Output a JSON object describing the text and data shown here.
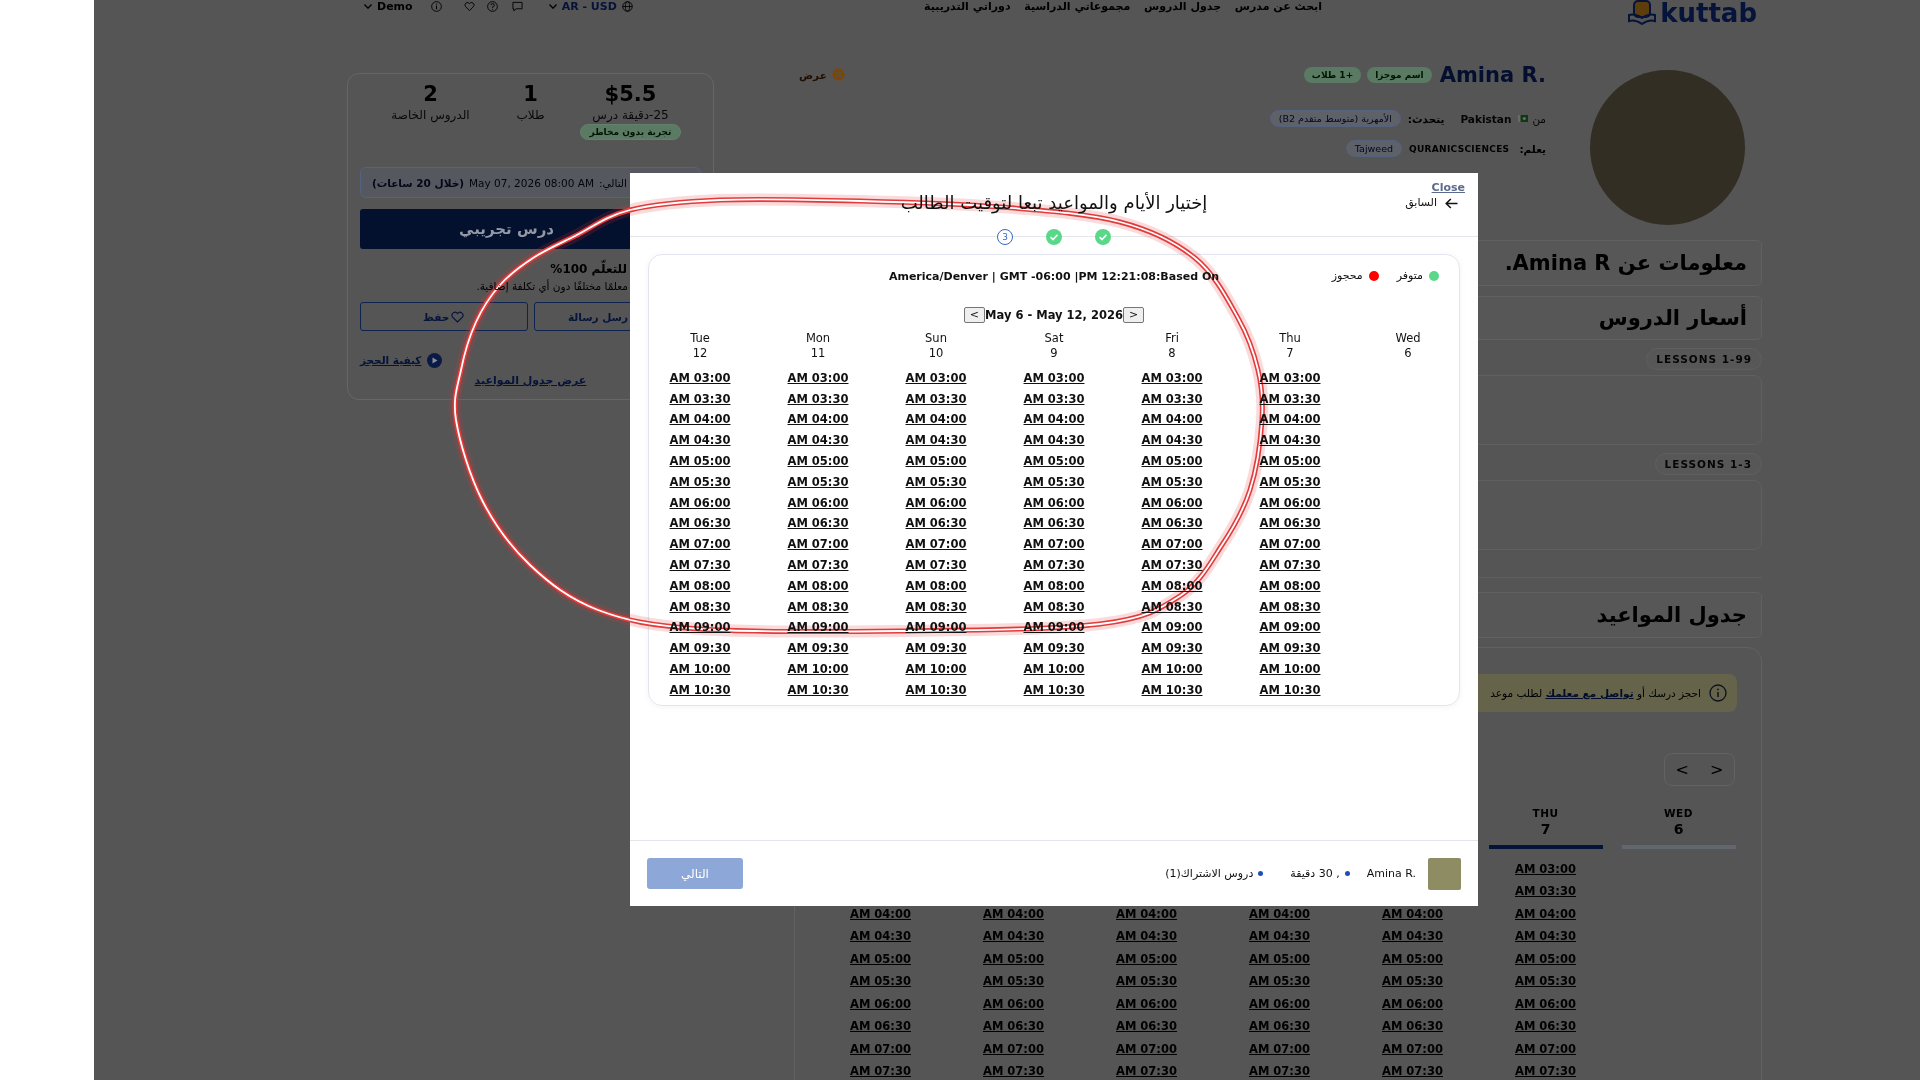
{
  "top_bar": {
    "account": "Demo",
    "currency": "AR - USD",
    "nav_links": [
      "ابحث عن مدرس",
      "جدول الدروس",
      "مجموعاتي الدراسية",
      "دوراتي التدريبية"
    ],
    "logo": "kuttab"
  },
  "booking_card": {
    "stats": {
      "price": {
        "value": "$5.5",
        "label": "25-دقيقة درس",
        "badge": "تجربة بدون مخاطر"
      },
      "students": {
        "value": "1",
        "label": "طلاب"
      },
      "lessons": {
        "value": "2",
        "label": "الدروس الخاصة"
      }
    },
    "next_lesson": {
      "label": "التالي:",
      "date": "May 07, 2026 08:00 AM",
      "remaining": "(خلال 20 ساعات)"
    },
    "trial_button": "درس تجريبي",
    "guarantee_title": "للتعلّم 100%",
    "guarantee_text": "معلمًا مختلفًا دون أي تكلفة إضافية.",
    "message_button": "رسل رسالة",
    "save_button": "حفظ",
    "how_to_book": "كيفية الحجز",
    "schedule_link": "عرض جدول المواعيد"
  },
  "profile": {
    "offer": "عرض",
    "name": "Amina R.",
    "badges": [
      "اسم موجزا",
      "+1 طلاب"
    ],
    "from_label": "من",
    "country": "Pakistan",
    "speaks_label": "يتحدث:",
    "language": "الأمهرية (متوسط متقدم B2)",
    "teaches_label": "يعلم:",
    "category": "QURANICSCIENCES",
    "subject": "Tajweed"
  },
  "sections": [
    {
      "title": "معلومات عن Amina R."
    },
    {
      "title": "أسعار الدروس"
    }
  ],
  "pricing_tiers": [
    {
      "label": "LESSONS 1-99"
    },
    {
      "label": "LESSONS 1-3"
    }
  ],
  "schedule_section": {
    "title": "جدول المواعيد",
    "notice": {
      "before": "احجز درسك أو",
      "link": "تواصل مع معلمك",
      "after": "لطلب موعد"
    },
    "nav": [
      "<",
      ">"
    ],
    "days": [
      {
        "times": [
          "AM 04:00",
          "AM 04:30",
          "AM 05:00",
          "AM 05:30",
          "AM 06:00",
          "AM 06:30",
          "AM 07:00",
          "AM 07:30"
        ]
      },
      {
        "times": [
          "AM 04:00",
          "AM 04:30",
          "AM 05:00",
          "AM 05:30",
          "AM 06:00",
          "AM 06:30",
          "AM 07:00",
          "AM 07:30"
        ]
      },
      {
        "times": [
          "AM 04:00",
          "AM 04:30",
          "AM 05:00",
          "AM 05:30",
          "AM 06:00",
          "AM 06:30",
          "AM 07:00",
          "AM 07:30"
        ]
      },
      {
        "times": [
          "AM 04:00",
          "AM 04:30",
          "AM 05:00",
          "AM 05:30",
          "AM 06:00",
          "AM 06:30",
          "AM 07:00",
          "AM 07:30"
        ]
      },
      {
        "times": [
          "AM 04:00",
          "AM 04:30",
          "AM 05:00",
          "AM 05:30",
          "AM 06:00",
          "AM 06:30",
          "AM 07:00",
          "AM 07:30"
        ]
      },
      {
        "day": "THU",
        "date": "7",
        "selected": true,
        "times": [
          "AM 03:00",
          "AM 03:30",
          "AM 04:00",
          "AM 04:30",
          "AM 05:00",
          "AM 05:30",
          "AM 06:00",
          "AM 06:30",
          "AM 07:00",
          "AM 07:30"
        ]
      },
      {
        "day": "WED",
        "date": "6",
        "selected": false
      }
    ]
  },
  "modal": {
    "close": "Close",
    "back": "السابق",
    "title": "إختيار الأيام والمواعيد تبعا لتوقيت الطالب",
    "steps": [
      {
        "done": false,
        "label": "3"
      },
      {
        "done": true
      },
      {
        "done": true
      }
    ],
    "legend": [
      {
        "label": "متوفر",
        "color": "#5ad88a"
      },
      {
        "label": "محجوز",
        "color": "#ff0000"
      }
    ],
    "timezone": "America/Denver | GMT -06:00 |PM 12:21:08:Based On",
    "week": {
      "prev": "<",
      "range": "May 6 - May 12, 2026",
      "next": ">"
    },
    "days": [
      {
        "day": "Tue",
        "date": "12",
        "times": [
          "AM 03:00",
          "AM 03:30",
          "AM 04:00",
          "AM 04:30",
          "AM 05:00",
          "AM 05:30",
          "AM 06:00",
          "AM 06:30",
          "AM 07:00",
          "AM 07:30",
          "AM 08:00",
          "AM 08:30",
          "AM 09:00",
          "AM 09:30",
          "AM 10:00",
          "AM 10:30"
        ]
      },
      {
        "day": "Mon",
        "date": "11",
        "times": [
          "AM 03:00",
          "AM 03:30",
          "AM 04:00",
          "AM 04:30",
          "AM 05:00",
          "AM 05:30",
          "AM 06:00",
          "AM 06:30",
          "AM 07:00",
          "AM 07:30",
          "AM 08:00",
          "AM 08:30",
          "AM 09:00",
          "AM 09:30",
          "AM 10:00",
          "AM 10:30"
        ]
      },
      {
        "day": "Sun",
        "date": "10",
        "times": [
          "AM 03:00",
          "AM 03:30",
          "AM 04:00",
          "AM 04:30",
          "AM 05:00",
          "AM 05:30",
          "AM 06:00",
          "AM 06:30",
          "AM 07:00",
          "AM 07:30",
          "AM 08:00",
          "AM 08:30",
          "AM 09:00",
          "AM 09:30",
          "AM 10:00",
          "AM 10:30"
        ]
      },
      {
        "day": "Sat",
        "date": "9",
        "times": [
          "AM 03:00",
          "AM 03:30",
          "AM 04:00",
          "AM 04:30",
          "AM 05:00",
          "AM 05:30",
          "AM 06:00",
          "AM 06:30",
          "AM 07:00",
          "AM 07:30",
          "AM 08:00",
          "AM 08:30",
          "AM 09:00",
          "AM 09:30",
          "AM 10:00",
          "AM 10:30"
        ]
      },
      {
        "day": "Fri",
        "date": "8",
        "times": [
          "AM 03:00",
          "AM 03:30",
          "AM 04:00",
          "AM 04:30",
          "AM 05:00",
          "AM 05:30",
          "AM 06:00",
          "AM 06:30",
          "AM 07:00",
          "AM 07:30",
          "AM 08:00",
          "AM 08:30",
          "AM 09:00",
          "AM 09:30",
          "AM 10:00",
          "AM 10:30"
        ]
      },
      {
        "day": "Thu",
        "date": "7",
        "times": [
          "AM 03:00",
          "AM 03:30",
          "AM 04:00",
          "AM 04:30",
          "AM 05:00",
          "AM 05:30",
          "AM 06:00",
          "AM 06:30",
          "AM 07:00",
          "AM 07:30",
          "AM 08:00",
          "AM 08:30",
          "AM 09:00",
          "AM 09:30",
          "AM 10:00",
          "AM 10:30"
        ]
      },
      {
        "day": "Wed",
        "date": "6"
      }
    ],
    "summary": {
      "teacher": "Amina R.",
      "details": [
        ", 30 دقيقة",
        "دروس الاشتراك(1)"
      ]
    },
    "next_button": {
      "label": "التالي",
      "disabled": true
    }
  }
}
